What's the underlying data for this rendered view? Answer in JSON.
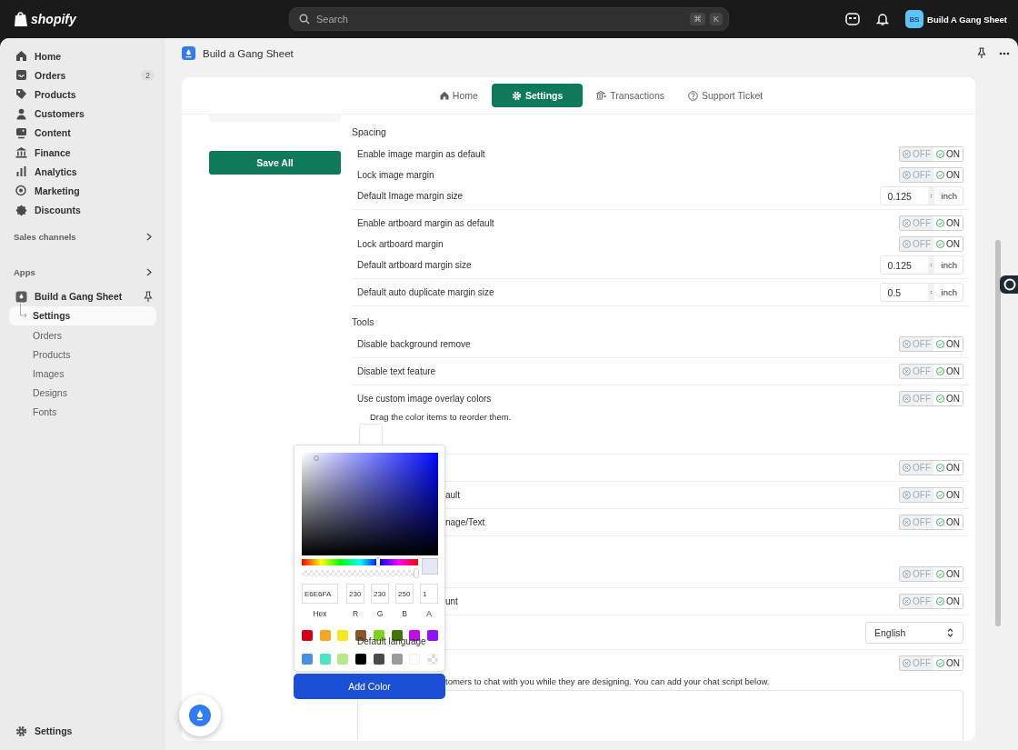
{
  "topbar": {
    "logo": "shopify",
    "search": {
      "placeholder": "Search",
      "keys": [
        "⌘",
        "K"
      ]
    },
    "account": {
      "initials": "BS",
      "name": "Build A Gang Sheet"
    }
  },
  "sidebar": {
    "items": [
      {
        "label": "Home"
      },
      {
        "label": "Orders",
        "badge": "2"
      },
      {
        "label": "Products"
      },
      {
        "label": "Customers"
      },
      {
        "label": "Content"
      },
      {
        "label": "Finance"
      },
      {
        "label": "Analytics"
      },
      {
        "label": "Marketing"
      },
      {
        "label": "Discounts"
      }
    ],
    "sections": [
      {
        "label": "Sales channels"
      },
      {
        "label": "Apps"
      }
    ],
    "app": {
      "label": "Build a Gang Sheet",
      "children": [
        {
          "label": "Settings",
          "selected": true
        },
        {
          "label": "Orders",
          "selected": false
        },
        {
          "label": "Products",
          "selected": false
        },
        {
          "label": "Images",
          "selected": false
        },
        {
          "label": "Designs",
          "selected": false
        },
        {
          "label": "Fonts",
          "selected": false
        }
      ]
    },
    "footer": {
      "label": "Settings"
    }
  },
  "app_header": {
    "title": "Build a Gang Sheet"
  },
  "tabs": [
    {
      "label": "Home",
      "selected": false
    },
    {
      "label": "Settings",
      "selected": true
    },
    {
      "label": "Transactions",
      "selected": false
    },
    {
      "label": "Support Ticket",
      "selected": false
    }
  ],
  "save_button": "Save All",
  "sections": [
    {
      "heading": "Spacing",
      "groups": [
        {
          "rows": [
            {
              "kind": "toggle",
              "label": "Enable image margin as default",
              "off_label": "OFF",
              "on_label": "ON",
              "on": true
            },
            {
              "kind": "toggle",
              "label": "Lock image margin",
              "off_label": "OFF",
              "on_label": "ON",
              "on": true
            },
            {
              "kind": "number",
              "label": "Default Image margin size",
              "value": "0.125",
              "unit": "inch"
            }
          ]
        },
        {
          "rows": [
            {
              "kind": "toggle",
              "label": "Enable artboard margin as default",
              "off_label": "OFF",
              "on_label": "ON",
              "on": true
            },
            {
              "kind": "toggle",
              "label": "Lock artboard margin",
              "off_label": "OFF",
              "on_label": "ON",
              "on": true
            },
            {
              "kind": "number",
              "label": "Default artboard margin size",
              "value": "0.125",
              "unit": "inch"
            }
          ]
        },
        {
          "rows": [
            {
              "kind": "number",
              "label": "Default auto duplicate margin size",
              "value": "0.5",
              "unit": "inch"
            }
          ]
        }
      ]
    },
    {
      "heading": "Tools",
      "groups": [
        {
          "rows": [
            {
              "kind": "toggle",
              "label": "Disable background remove",
              "off_label": "OFF",
              "on_label": "ON",
              "on": true
            }
          ]
        },
        {
          "rows": [
            {
              "kind": "toggle",
              "label": "Disable text feature",
              "off_label": "OFF",
              "on_label": "ON",
              "on": true
            }
          ]
        },
        {
          "rows": [
            {
              "kind": "toggle",
              "label": "Use custom image overlay colors",
              "off_label": "OFF",
              "on_label": "ON",
              "on": true
            },
            {
              "kind": "note",
              "text": "Drag the color items to reorder them."
            },
            {
              "kind": "color-slot"
            }
          ]
        },
        {
          "rows": [
            {
              "kind": "toggle",
              "off_label": "OFF",
              "on_label": "ON",
              "on": true
            }
          ]
        },
        {
          "rows": [
            {
              "kind": "toggle",
              "label": "ault",
              "covered": true,
              "off_label": "OFF",
              "on_label": "ON",
              "on": true
            }
          ]
        },
        {
          "rows": [
            {
              "kind": "toggle",
              "label": "nage/Text",
              "covered": true,
              "off_label": "OFF",
              "on_label": "ON",
              "on": true
            }
          ]
        }
      ]
    },
    {
      "groups": [
        {
          "rows": [
            {
              "kind": "toggle",
              "off_label": "OFF",
              "on_label": "ON",
              "on": true
            }
          ]
        },
        {
          "rows": [
            {
              "kind": "toggle",
              "label": "unt",
              "covered": true,
              "off_label": "OFF",
              "on_label": "ON",
              "on": true
            }
          ]
        },
        {
          "rows": [
            {
              "kind": "select",
              "label": "Default language",
              "value": "English"
            }
          ]
        },
        {
          "rows": [
            {
              "kind": "toggle",
              "off_label": "OFF",
              "on_label": "ON",
              "on": true
            },
            {
              "kind": "note",
              "text": "tomers to chat with you while they are designing. You can add your chat script below.",
              "covered": true
            },
            {
              "kind": "textarea"
            }
          ]
        }
      ]
    }
  ],
  "color_picker": {
    "hex": "E6E6FA",
    "hex_label": "Hex",
    "channels": [
      {
        "label": "R",
        "value": "230"
      },
      {
        "label": "G",
        "value": "230"
      },
      {
        "label": "B",
        "value": "250"
      },
      {
        "label": "A",
        "value": "1"
      }
    ],
    "hue": {
      "level": 0.66
    },
    "alpha": {
      "level": 1
    },
    "swatches": [
      {
        "kind": "solid",
        "color": "#d0021b"
      },
      {
        "kind": "solid",
        "color": "#f5a623"
      },
      {
        "kind": "solid",
        "color": "#f8e71c"
      },
      {
        "kind": "solid",
        "color": "#8b572a"
      },
      {
        "kind": "solid",
        "color": "#7ed321"
      },
      {
        "kind": "solid",
        "color": "#417505"
      },
      {
        "kind": "solid",
        "color": "#bd10e0"
      },
      {
        "kind": "solid",
        "color": "#9013fe"
      },
      {
        "kind": "solid",
        "color": "#4a90e2"
      },
      {
        "kind": "solid",
        "color": "#50e3c2"
      },
      {
        "kind": "solid",
        "color": "#b8e986"
      },
      {
        "kind": "solid",
        "color": "#000000"
      },
      {
        "kind": "solid",
        "color": "#4a4a4a"
      },
      {
        "kind": "solid",
        "color": "#9b9b9b"
      },
      {
        "kind": "solid",
        "color": "#ffffff"
      },
      {
        "kind": "transparent"
      }
    ],
    "button": "Add Color"
  }
}
